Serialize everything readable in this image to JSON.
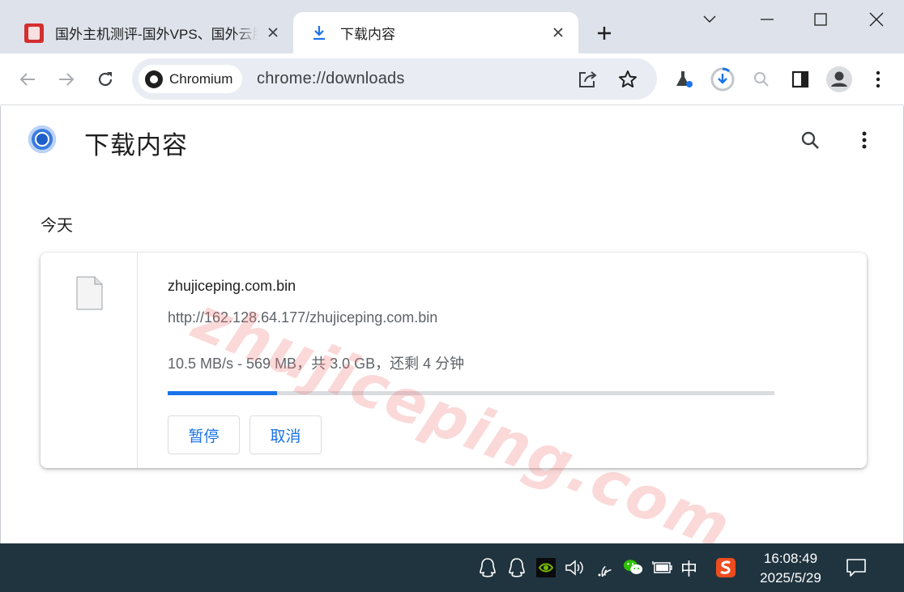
{
  "tabs": [
    {
      "title": "国外主机测评-国外VPS、国外云服务器",
      "active": false
    },
    {
      "title": "下载内容",
      "active": true
    }
  ],
  "omnibox": {
    "chip_label": "Chromium",
    "url": "chrome://downloads"
  },
  "page": {
    "title": "下载内容",
    "section_label": "今天",
    "watermark": "zhujiceping.com"
  },
  "download": {
    "file_name": "zhujiceping.com.bin",
    "url": "http://162.128.64.177/zhujiceping.com.bin",
    "status": "10.5 MB/s - 569 MB，共 3.0 GB，还剩 4 分钟",
    "progress": 0.18,
    "pause_label": "暂停",
    "cancel_label": "取消"
  },
  "taskbar": {
    "ime_label": "中",
    "time": "16:08:49",
    "date": "2025/5/29"
  },
  "colors": {
    "accent": "#1a73e8",
    "tabstrip": "#dee3eb",
    "omnibox": "#e9edf3",
    "taskbar": "#20343f"
  }
}
